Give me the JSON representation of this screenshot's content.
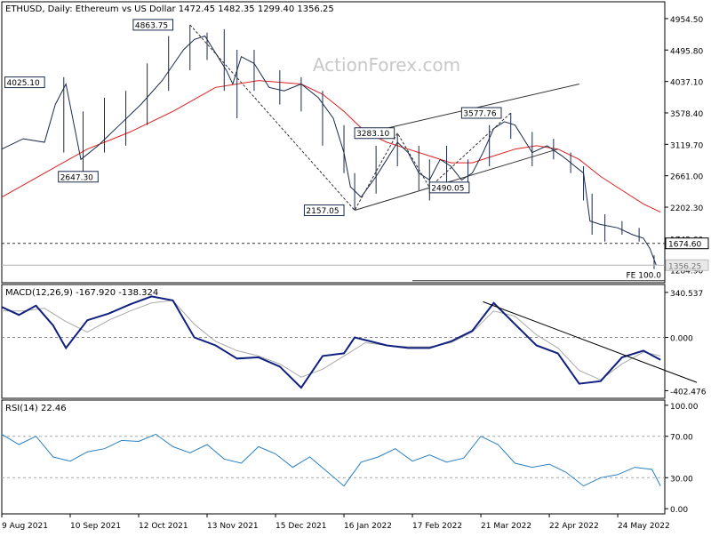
{
  "chart_data": [
    {
      "type": "line",
      "panel": "price",
      "header": "ETHUSD, Daily:  Ethereum vs US Dollar  1472.45 1482.35 1299.40 1356.25",
      "watermark": "ActionForex.com",
      "ylim": [
        1100,
        5200
      ],
      "yticks": [
        "4954.50",
        "4495.80",
        "4037.10",
        "3578.40",
        "3119.70",
        "2661.00",
        "2202.30",
        "1743.60",
        "1284.90"
      ],
      "ytick_values": [
        4954.5,
        4495.8,
        4037.1,
        3578.4,
        3119.7,
        2661.0,
        2202.3,
        1743.6,
        1284.9
      ],
      "xlim": [
        0,
        300
      ],
      "x_ticks": [
        {
          "label": "9 Aug 2021",
          "x": 0
        },
        {
          "label": "10 Sep 2021",
          "x": 32
        },
        {
          "label": "12 Oct 2021",
          "x": 64
        },
        {
          "label": "13 Nov 2021",
          "x": 96
        },
        {
          "label": "15 Dec 2021",
          "x": 128
        },
        {
          "label": "16 Jan 2022",
          "x": 160
        },
        {
          "label": "17 Feb 2022",
          "x": 192
        },
        {
          "label": "21 Mar 2022",
          "x": 224
        },
        {
          "label": "22 Apr 2022",
          "x": 256
        },
        {
          "label": "24 May 2022",
          "x": 288
        }
      ],
      "close_x": [
        0,
        10,
        20,
        25,
        30,
        37,
        45,
        55,
        65,
        75,
        85,
        90,
        95,
        100,
        105,
        108,
        112,
        118,
        125,
        132,
        140,
        148,
        155,
        160,
        163,
        168,
        175,
        180,
        185,
        190,
        195,
        200,
        205,
        210,
        215,
        220,
        225,
        230,
        235,
        240,
        248,
        255,
        262,
        268,
        272,
        275,
        280,
        288,
        295,
        300,
        303,
        306
      ],
      "close_y": [
        3050,
        3200,
        3150,
        3700,
        4000,
        2900,
        3100,
        3400,
        3700,
        4050,
        4500,
        4650,
        4700,
        4450,
        4200,
        4000,
        4400,
        4300,
        3950,
        3900,
        4000,
        3800,
        3500,
        3000,
        2500,
        2350,
        2650,
        2900,
        3150,
        3000,
        2700,
        2600,
        2900,
        2800,
        2600,
        2700,
        3000,
        3350,
        3450,
        3400,
        3000,
        3100,
        2950,
        2800,
        2700,
        2000,
        1950,
        1900,
        1800,
        1750,
        1600,
        1356
      ],
      "price_bars": [
        {
          "x": 29,
          "low": 3000,
          "high": 4100
        },
        {
          "x": 38,
          "low": 2700,
          "high": 3600
        },
        {
          "x": 48,
          "low": 3000,
          "high": 3800
        },
        {
          "x": 58,
          "low": 3100,
          "high": 3900
        },
        {
          "x": 68,
          "low": 3400,
          "high": 4300
        },
        {
          "x": 78,
          "low": 3900,
          "high": 4700
        },
        {
          "x": 88,
          "low": 4200,
          "high": 4864
        },
        {
          "x": 96,
          "low": 4350,
          "high": 4750
        },
        {
          "x": 104,
          "low": 3900,
          "high": 4800
        },
        {
          "x": 110,
          "low": 3500,
          "high": 4500
        },
        {
          "x": 118,
          "low": 3900,
          "high": 4500
        },
        {
          "x": 130,
          "low": 3700,
          "high": 4200
        },
        {
          "x": 140,
          "low": 3600,
          "high": 4100
        },
        {
          "x": 150,
          "low": 3100,
          "high": 3900
        },
        {
          "x": 160,
          "low": 2700,
          "high": 3400
        },
        {
          "x": 165,
          "low": 2157,
          "high": 2700
        },
        {
          "x": 175,
          "low": 2400,
          "high": 3100
        },
        {
          "x": 185,
          "low": 2800,
          "high": 3283
        },
        {
          "x": 195,
          "low": 2450,
          "high": 3100
        },
        {
          "x": 200,
          "low": 2300,
          "high": 2900
        },
        {
          "x": 208,
          "low": 2500,
          "high": 3100
        },
        {
          "x": 218,
          "low": 2490,
          "high": 2900
        },
        {
          "x": 228,
          "low": 2800,
          "high": 3400
        },
        {
          "x": 238,
          "low": 3200,
          "high": 3578
        },
        {
          "x": 248,
          "low": 2800,
          "high": 3300
        },
        {
          "x": 258,
          "low": 2900,
          "high": 3200
        },
        {
          "x": 266,
          "low": 2700,
          "high": 3000
        },
        {
          "x": 272,
          "low": 2300,
          "high": 2800
        },
        {
          "x": 276,
          "low": 1800,
          "high": 2400
        },
        {
          "x": 282,
          "low": 1700,
          "high": 2100
        },
        {
          "x": 290,
          "low": 1800,
          "high": 2000
        },
        {
          "x": 298,
          "low": 1700,
          "high": 1900
        },
        {
          "x": 305,
          "low": 1299,
          "high": 1500
        }
      ],
      "ma_x": [
        0,
        20,
        40,
        60,
        80,
        100,
        120,
        140,
        150,
        160,
        170,
        180,
        190,
        200,
        210,
        220,
        230,
        240,
        250,
        260,
        270,
        280,
        290,
        300,
        308
      ],
      "ma_y": [
        2350,
        2700,
        3050,
        3300,
        3600,
        3950,
        4050,
        4000,
        3850,
        3600,
        3300,
        3150,
        3050,
        2950,
        2850,
        2850,
        2950,
        3050,
        3100,
        3050,
        2900,
        2650,
        2450,
        2250,
        2130
      ],
      "labels": [
        {
          "text": "4863.75",
          "x": 80,
          "y": 4864,
          "pos": "left"
        },
        {
          "text": "4025.10",
          "x": 20,
          "y": 4025,
          "pos": "left"
        },
        {
          "text": "2647.30",
          "x": 45,
          "y": 2647,
          "pos": "left"
        },
        {
          "text": "2157.05",
          "x": 160,
          "y": 2157,
          "pos": "left"
        },
        {
          "text": "3283.10",
          "x": 165,
          "y": 3283,
          "pos": "right"
        },
        {
          "text": "2490.05",
          "x": 200,
          "y": 2490,
          "pos": "right"
        },
        {
          "text": "3577.76",
          "x": 215,
          "y": 3578,
          "pos": "right"
        }
      ],
      "dashed_zigzag": {
        "x": [
          88,
          165,
          185,
          200,
          238
        ],
        "y": [
          4864,
          2157,
          3283,
          2490,
          3578
        ]
      },
      "channel_lower": {
        "x": [
          165,
          260
        ],
        "y": [
          2157,
          3050
        ]
      },
      "channel_upper": {
        "x": [
          170,
          270
        ],
        "y": [
          3283,
          4000
        ]
      },
      "hline": {
        "y": 1674.6,
        "label": "1674.60"
      },
      "last_price": {
        "y": 1356.25,
        "label": "1356.25"
      },
      "fe_label": "FE 100.0",
      "fe_y": 1130
    },
    {
      "type": "line",
      "panel": "macd",
      "header": "MACD(12,26,9) -167.920 -138.324",
      "ylim": [
        -460,
        400
      ],
      "yticks": [
        "340.537",
        "0.000",
        "-402.476"
      ],
      "ytick_values": [
        340.537,
        0,
        -402.476
      ],
      "macd_x": [
        0,
        8,
        16,
        24,
        30,
        40,
        50,
        60,
        70,
        80,
        90,
        100,
        110,
        120,
        130,
        140,
        150,
        160,
        165,
        170,
        180,
        190,
        200,
        210,
        220,
        230,
        240,
        250,
        260,
        270,
        280,
        290,
        300,
        308
      ],
      "macd_y": [
        230,
        170,
        240,
        90,
        -80,
        130,
        180,
        250,
        310,
        280,
        0,
        -60,
        -160,
        -150,
        -220,
        -380,
        -140,
        -120,
        0,
        -20,
        -60,
        -80,
        -80,
        -30,
        50,
        260,
        100,
        -60,
        -120,
        -350,
        -330,
        -150,
        -100,
        -170
      ],
      "signal_x": [
        0,
        10,
        20,
        30,
        40,
        50,
        60,
        70,
        80,
        90,
        100,
        110,
        120,
        130,
        140,
        150,
        160,
        170,
        180,
        190,
        200,
        210,
        220,
        230,
        240,
        250,
        260,
        270,
        280,
        290,
        300,
        308
      ],
      "signal_y": [
        200,
        200,
        220,
        120,
        40,
        130,
        200,
        260,
        280,
        100,
        -30,
        -100,
        -140,
        -200,
        -300,
        -240,
        -140,
        -40,
        -60,
        -70,
        -70,
        -40,
        40,
        200,
        160,
        20,
        -80,
        -250,
        -320,
        -200,
        -110,
        -140
      ],
      "trendline": {
        "x": [
          225,
          325
        ],
        "y": [
          270,
          -340
        ]
      },
      "zero_line_dashed": true
    },
    {
      "type": "line",
      "panel": "rsi",
      "header": "RSI(14) 22.46",
      "ylim": [
        -5,
        105
      ],
      "yticks": [
        "100.00",
        "70.00",
        "30.00",
        "0.00"
      ],
      "ytick_values": [
        100,
        70,
        30,
        0
      ],
      "rsi_x": [
        0,
        8,
        16,
        24,
        32,
        40,
        48,
        56,
        64,
        72,
        80,
        88,
        96,
        104,
        112,
        120,
        128,
        136,
        144,
        152,
        160,
        168,
        176,
        184,
        192,
        200,
        208,
        216,
        224,
        232,
        240,
        248,
        256,
        264,
        272,
        280,
        288,
        296,
        304,
        308
      ],
      "rsi_y": [
        72,
        62,
        70,
        50,
        46,
        55,
        58,
        66,
        65,
        72,
        60,
        54,
        62,
        48,
        44,
        60,
        53,
        40,
        50,
        36,
        22,
        45,
        50,
        58,
        46,
        52,
        45,
        49,
        70,
        62,
        44,
        40,
        43,
        35,
        22,
        30,
        33,
        40,
        38,
        22
      ]
    }
  ]
}
